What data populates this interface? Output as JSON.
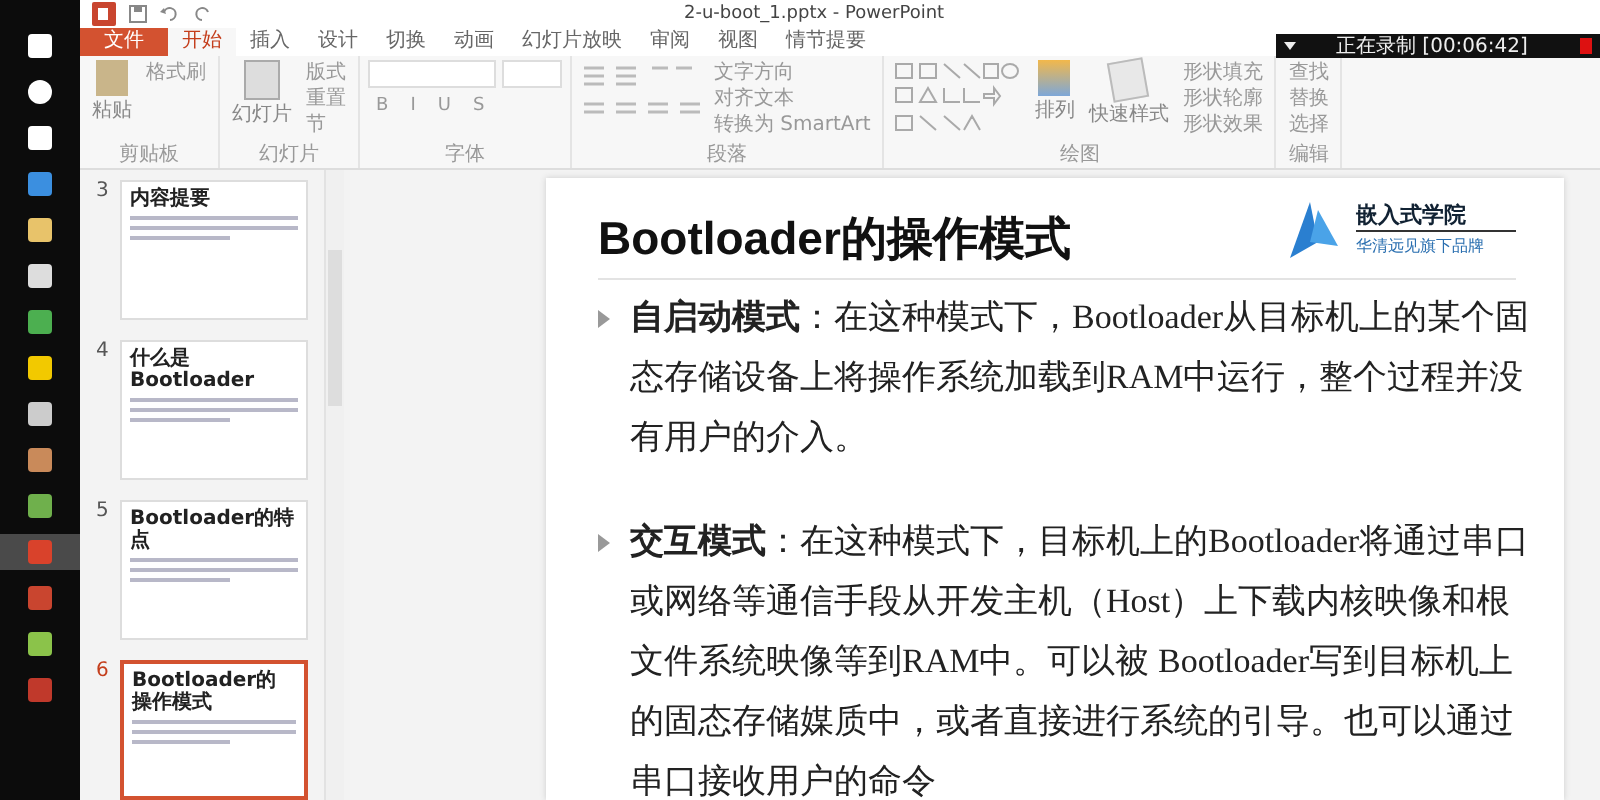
{
  "window": {
    "title": "2-u-boot_1.pptx - PowerPoint"
  },
  "recorder": {
    "status": "正在录制 [00:06:42]"
  },
  "taskbar": {
    "apps": [
      {
        "selected": false
      },
      {
        "selected": false
      },
      {
        "selected": false
      },
      {
        "selected": false
      },
      {
        "selected": false
      },
      {
        "selected": false
      },
      {
        "selected": false
      },
      {
        "selected": false
      },
      {
        "selected": false
      },
      {
        "selected": false
      },
      {
        "selected": false
      },
      {
        "selected": true
      },
      {
        "selected": false
      },
      {
        "selected": false
      },
      {
        "selected": false
      }
    ]
  },
  "tabs": [
    {
      "label": "文件",
      "kind": "file",
      "selected": false
    },
    {
      "label": "开始",
      "kind": "tab",
      "selected": true
    },
    {
      "label": "插入",
      "kind": "tab",
      "selected": false
    },
    {
      "label": "设计",
      "kind": "tab",
      "selected": false
    },
    {
      "label": "切换",
      "kind": "tab",
      "selected": false
    },
    {
      "label": "动画",
      "kind": "tab",
      "selected": false
    },
    {
      "label": "幻灯片放映",
      "kind": "tab",
      "selected": false
    },
    {
      "label": "审阅",
      "kind": "tab",
      "selected": false
    },
    {
      "label": "视图",
      "kind": "tab",
      "selected": false
    },
    {
      "label": "情节提要",
      "kind": "tab",
      "selected": false
    }
  ],
  "ribbon": {
    "clipboard": {
      "paste": "粘贴",
      "format_painter": "格式刷",
      "label": "剪贴板"
    },
    "slides": {
      "new_slide": "幻灯片",
      "layout": "版式",
      "reset": "重置",
      "section": "节",
      "label": "幻灯片"
    },
    "font": {
      "buttons": [
        "B",
        "I",
        "U",
        "S"
      ],
      "label": "字体"
    },
    "paragraph": {
      "commands": [
        "文字方向",
        "对齐文本",
        "转换为 SmartArt"
      ],
      "label": "段落"
    },
    "drawing": {
      "arrange": "排列",
      "quick_styles": "快速样式",
      "commands": [
        "形状填充",
        "形状轮廓",
        "形状效果"
      ],
      "label": "绘图"
    },
    "editing": {
      "commands": [
        "查找",
        "替换",
        "选择"
      ],
      "label": "编辑"
    }
  },
  "thumbnails": [
    {
      "number": "3",
      "title": "内容提要",
      "selected": false
    },
    {
      "number": "4",
      "title": "什么是Bootloader",
      "selected": false
    },
    {
      "number": "5",
      "title": "Bootloader的特点",
      "selected": false
    },
    {
      "number": "6",
      "title": "Bootloader的操作模式",
      "selected": true
    }
  ],
  "slide": {
    "title": "Bootloader的操作模式",
    "logo_name": "嵌入式学院",
    "logo_tagline": "华清远见旗下品牌",
    "bullets": [
      "**自启动模式**：在这种模式下，Bootloader从目标机上的某个固态存储设备上将操作系统加载到RAM中运行，整个过程并没有用户的介入。",
      "**交互模式**：在这种模式下，目标机上的Bootloader将通过串口或网络等通信手段从开发主机（Host）上下载内核映像和根文件系统映像等到RAM中。可以被 Bootloader写到目标机上的固态存储媒质中，或者直接进行系统的引导。也可以通过串口接收用户的命令"
    ]
  }
}
